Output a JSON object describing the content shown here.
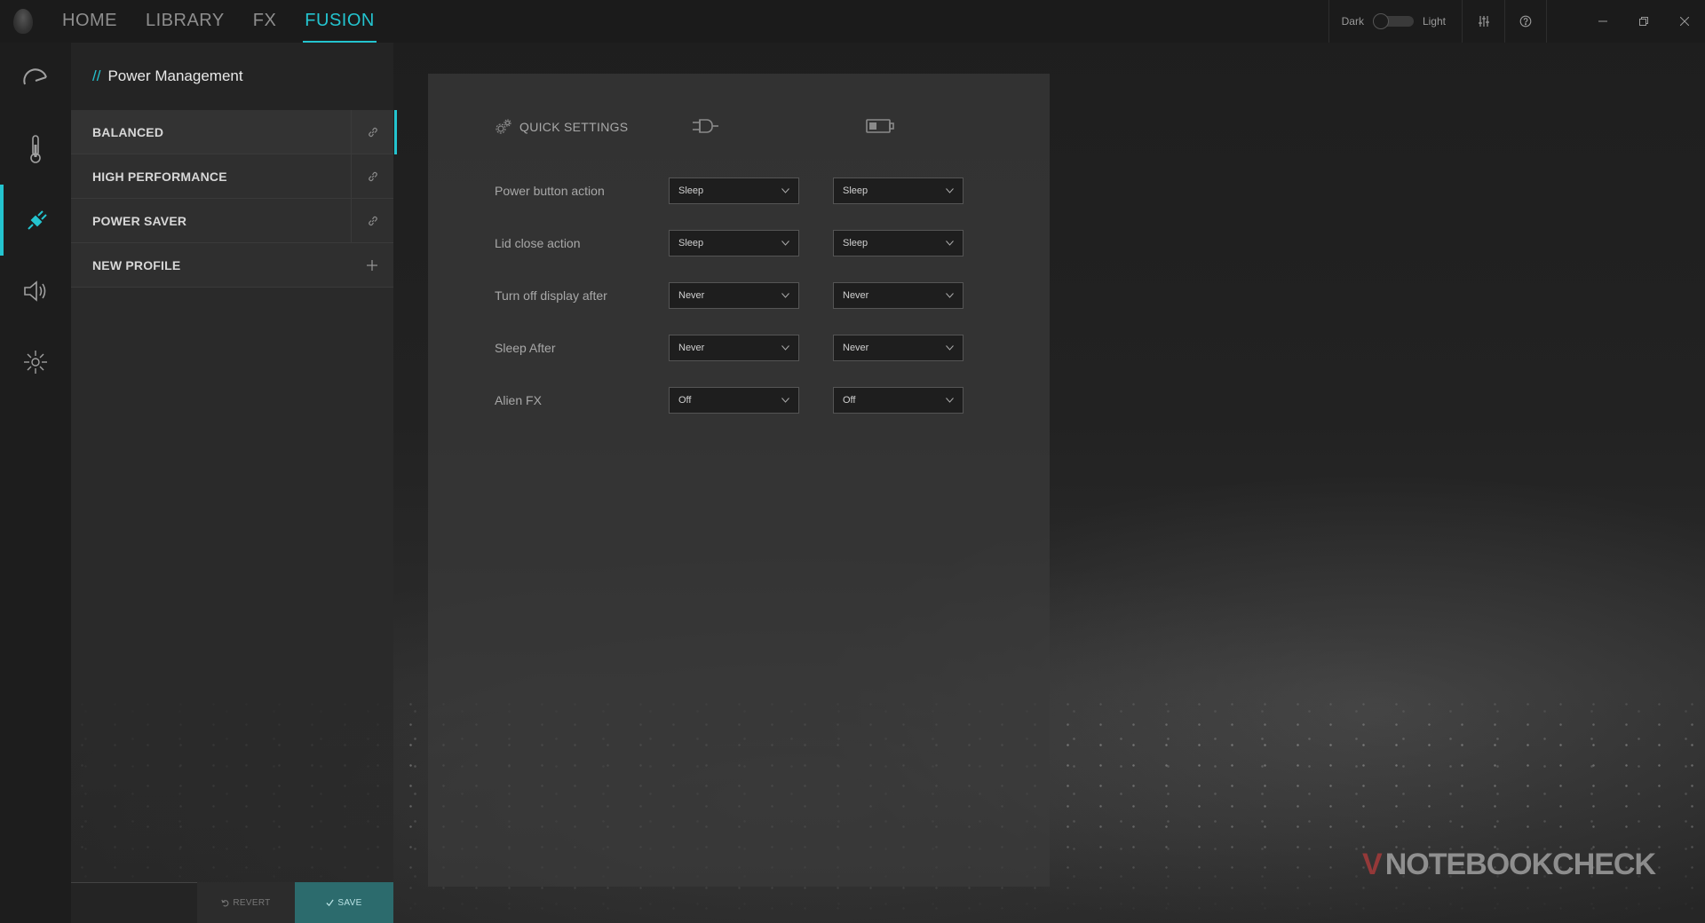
{
  "nav": {
    "tabs": [
      {
        "label": "HOME"
      },
      {
        "label": "LIBRARY"
      },
      {
        "label": "FX"
      },
      {
        "label": "FUSION"
      }
    ],
    "active": "FUSION"
  },
  "theme": {
    "dark_label": "Dark",
    "light_label": "Light"
  },
  "rail": {
    "icons": [
      "overclock-gauge-icon",
      "thermometer-icon",
      "power-plug-icon",
      "speaker-icon",
      "brightness-icon"
    ],
    "active": "power-plug-icon"
  },
  "profiles": {
    "title_prefix": "//",
    "title": "Power Management",
    "items": [
      {
        "name": "BALANCED",
        "action_icon": "link-icon"
      },
      {
        "name": "HIGH PERFORMANCE",
        "action_icon": "link-icon"
      },
      {
        "name": "POWER SAVER",
        "action_icon": "link-icon"
      },
      {
        "name": "NEW PROFILE",
        "action_icon": "plus-icon"
      }
    ],
    "active": "BALANCED",
    "revert_label": "REVERT",
    "save_label": "SAVE"
  },
  "quick_settings": {
    "title": "QUICK SETTINGS",
    "columns": [
      "plugged-in-icon",
      "battery-icon"
    ],
    "rows": [
      {
        "label": "Power button action",
        "ac": "Sleep",
        "battery": "Sleep"
      },
      {
        "label": "Lid close action",
        "ac": "Sleep",
        "battery": "Sleep"
      },
      {
        "label": "Turn off display after",
        "ac": "Never",
        "battery": "Never"
      },
      {
        "label": "Sleep After",
        "ac": "Never",
        "battery": "Never"
      },
      {
        "label": "Alien FX",
        "ac": "Off",
        "battery": "Off"
      }
    ]
  },
  "watermark": {
    "text": "NOTEBOOKCHECK",
    "v": "V"
  },
  "colors": {
    "accent": "#24c4cf",
    "save": "#2c6b6d"
  }
}
